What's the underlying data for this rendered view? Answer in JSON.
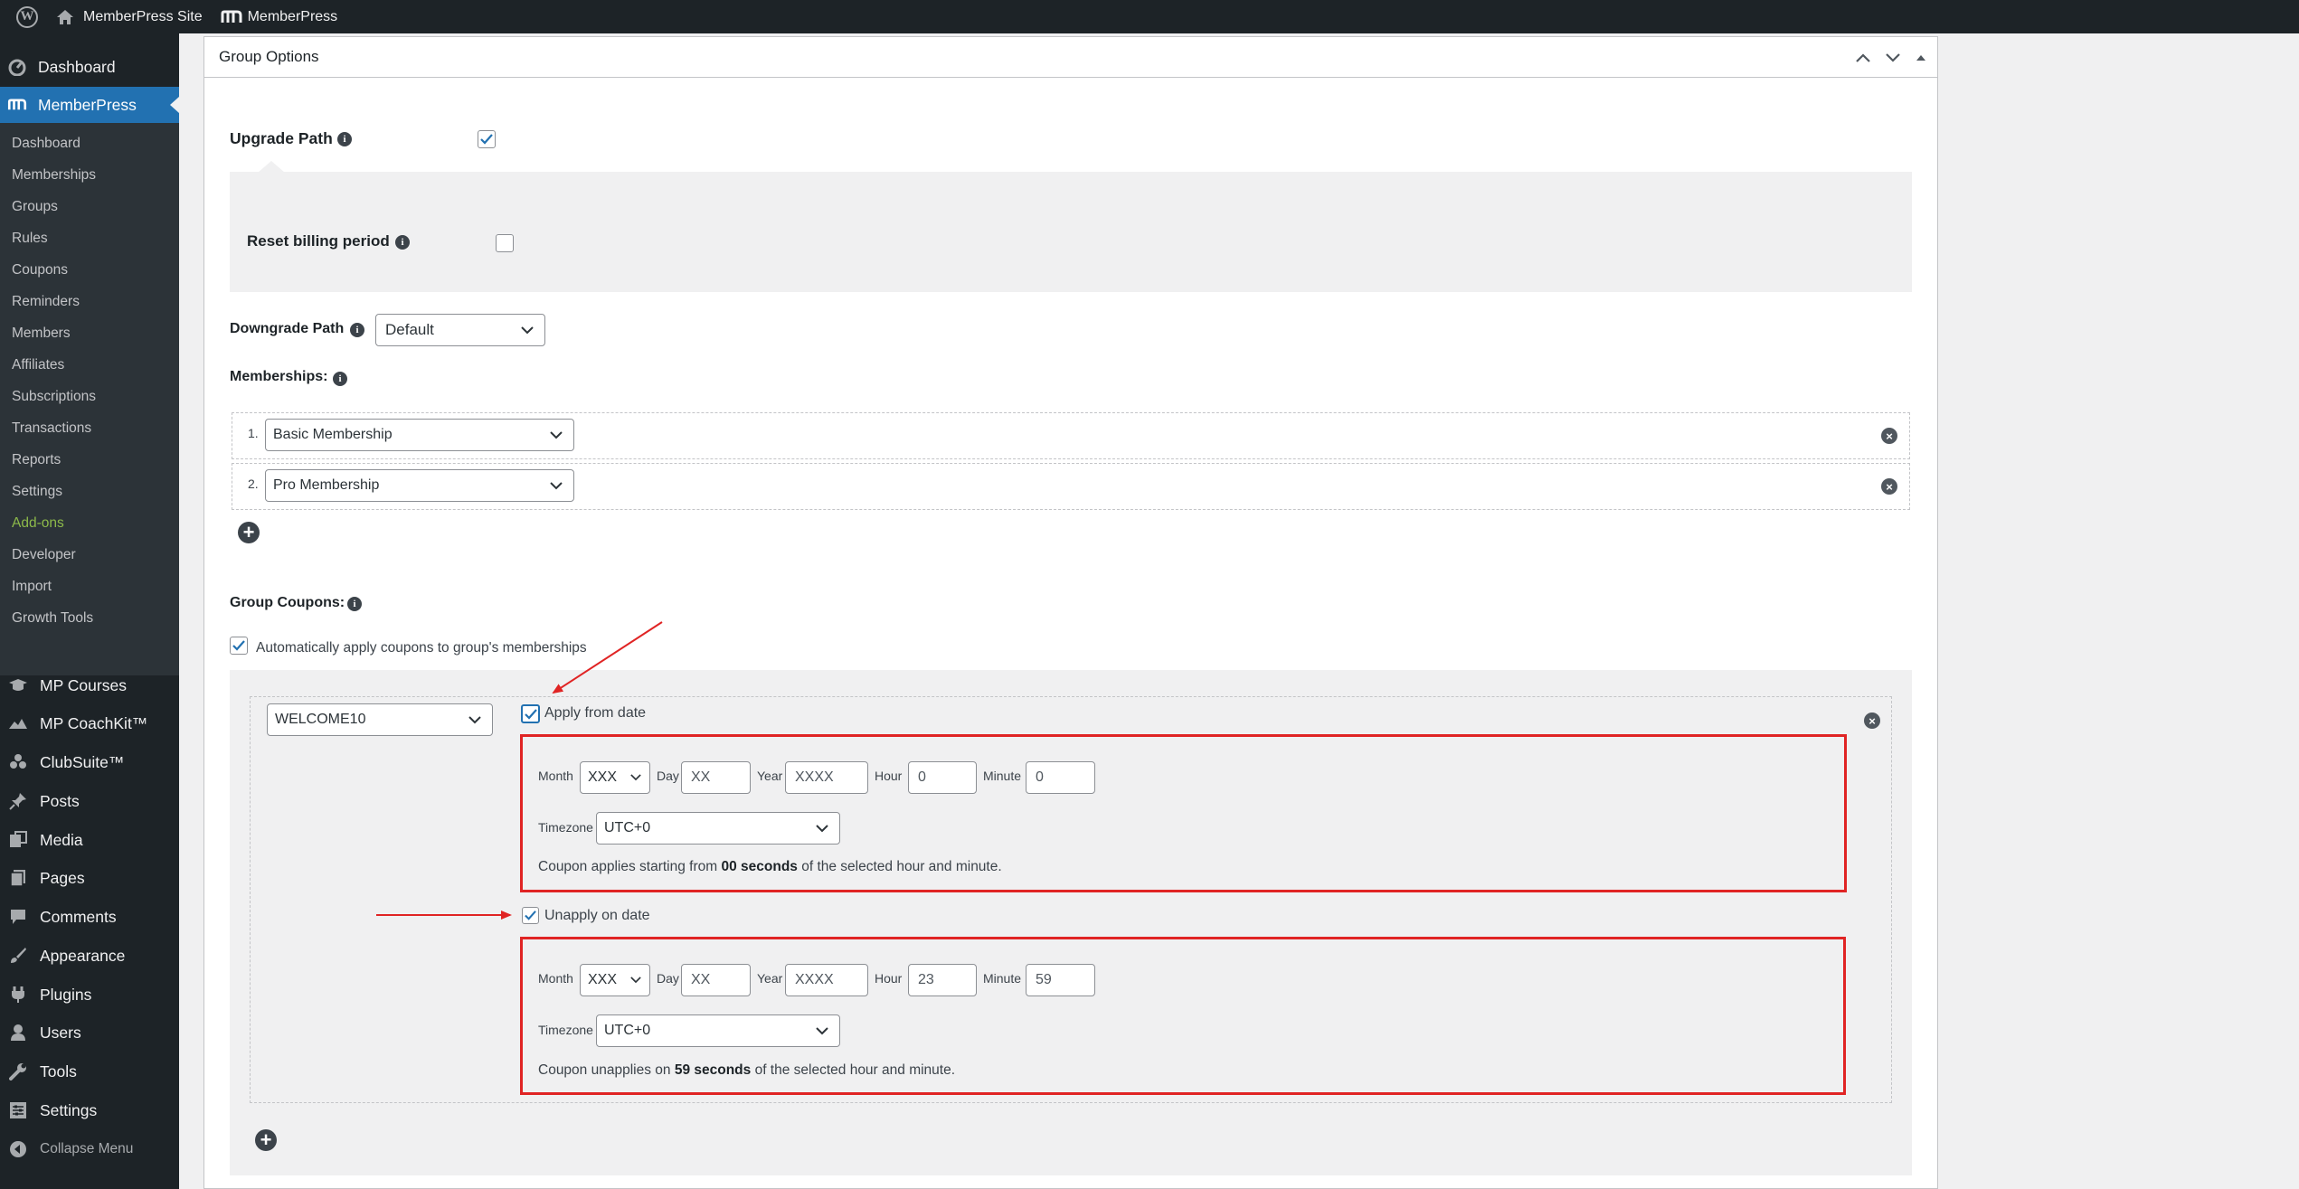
{
  "admin_bar": {
    "wp_logo": "W",
    "site_name": "MemberPress Site",
    "plugin_name": "MemberPress"
  },
  "sidebar": {
    "top_items": [
      {
        "label": "Dashboard",
        "icon": "dashboard-icon"
      },
      {
        "label": "MemberPress",
        "icon": "memberpress-icon"
      }
    ],
    "submenu": [
      "Dashboard",
      "Memberships",
      "Groups",
      "Rules",
      "Coupons",
      "Reminders",
      "Members",
      "Affiliates",
      "Subscriptions",
      "Transactions",
      "Reports",
      "Settings",
      "Add-ons",
      "Developer",
      "Import",
      "Growth Tools"
    ],
    "lower_items": [
      {
        "label": "MP Courses",
        "icon": "courses-icon"
      },
      {
        "label": "MP CoachKit™",
        "icon": "coachkit-icon"
      },
      {
        "label": "ClubSuite™",
        "icon": "clubsuite-icon"
      },
      {
        "label": "Posts",
        "icon": "pin-icon"
      },
      {
        "label": "Media",
        "icon": "media-icon"
      },
      {
        "label": "Pages",
        "icon": "pages-icon"
      },
      {
        "label": "Comments",
        "icon": "comment-icon"
      },
      {
        "label": "Appearance",
        "icon": "brush-icon"
      },
      {
        "label": "Plugins",
        "icon": "plugin-icon"
      },
      {
        "label": "Users",
        "icon": "user-icon"
      },
      {
        "label": "Tools",
        "icon": "wrench-icon"
      },
      {
        "label": "Settings",
        "icon": "settings-icon"
      },
      {
        "label": "Collapse Menu",
        "icon": "collapse-icon"
      }
    ]
  },
  "postbox": {
    "title": "Group Options"
  },
  "upgrade": {
    "label": "Upgrade Path",
    "checked": true,
    "reset_label": "Reset billing period",
    "reset_checked": false
  },
  "downgrade": {
    "label": "Downgrade Path",
    "value": "Default"
  },
  "memberships": {
    "label": "Memberships:",
    "items": [
      {
        "index": "1.",
        "value": "Basic Membership"
      },
      {
        "index": "2.",
        "value": "Pro Membership"
      }
    ]
  },
  "coupons": {
    "label": "Group Coupons:",
    "auto_apply_label": "Automatically apply coupons to group's memberships",
    "coupon_value": "WELCOME10",
    "apply_from": {
      "label": "Apply from date",
      "month_label": "Month",
      "month_value": "XXX",
      "day_label": "Day",
      "day_value": "XX",
      "year_label": "Year",
      "year_value": "XXXX",
      "hour_label": "Hour",
      "hour_value": "0",
      "minute_label": "Minute",
      "minute_value": "0",
      "timezone_label": "Timezone",
      "timezone_value": "UTC+0",
      "note_pre": "Coupon applies starting from ",
      "note_bold": "00 seconds",
      "note_post": " of the selected hour and minute."
    },
    "unapply_on": {
      "label": "Unapply on date",
      "month_label": "Month",
      "month_value": "XXX",
      "day_label": "Day",
      "day_value": "XX",
      "year_label": "Year",
      "year_value": "XXXX",
      "hour_label": "Hour",
      "hour_value": "23",
      "minute_label": "Minute",
      "minute_value": "59",
      "timezone_label": "Timezone",
      "timezone_value": "UTC+0",
      "note_pre": "Coupon unapplies on ",
      "note_bold": "59 seconds",
      "note_post": " of the selected hour and minute."
    }
  },
  "colors": {
    "admin_dark": "#1d2327",
    "submenu_bg": "#2c3338",
    "accent_blue": "#2271b1",
    "addons_green": "#8dba4a",
    "annotation_red": "#e02424",
    "panel_gray": "#f0f0f1"
  }
}
